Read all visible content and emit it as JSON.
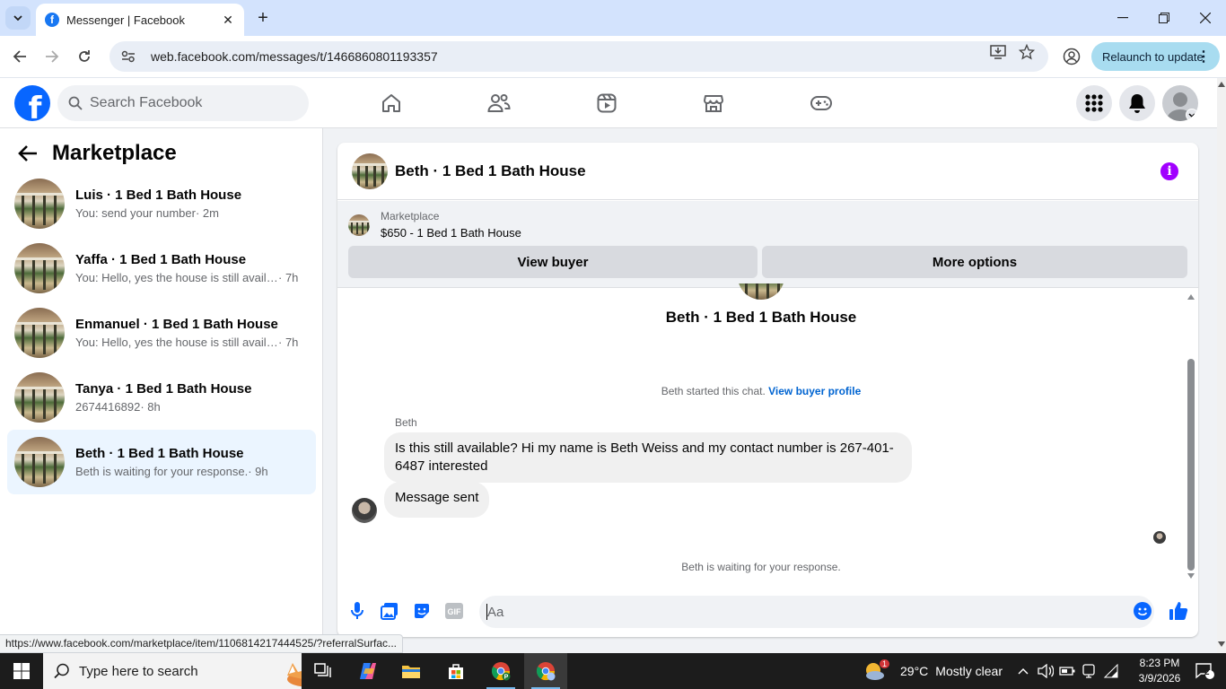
{
  "browser": {
    "tab_title": "Messenger | Facebook",
    "url": "web.facebook.com/messages/t/1466860801193357",
    "relaunch_label": "Relaunch to update",
    "status_url": "https://www.facebook.com/marketplace/item/1106814217444525/?referralSurfac..."
  },
  "header": {
    "search_placeholder": "Search Facebook",
    "nav": [
      "home-icon",
      "friends-icon",
      "watch-icon",
      "marketplace-icon",
      "gaming-icon"
    ]
  },
  "sidebar": {
    "title": "Marketplace",
    "conversations": [
      {
        "name": "Luis · 1 Bed 1 Bath House",
        "snippet": "You: send your number",
        "time": "· 2m",
        "active": false
      },
      {
        "name": "Yaffa · 1 Bed 1 Bath House",
        "snippet": "You: Hello, yes the house is still available",
        "time": "· 7h",
        "active": false
      },
      {
        "name": "Enmanuel · 1 Bed 1 Bath House",
        "snippet": "You: Hello, yes the house is still available",
        "time": "· 7h",
        "active": false
      },
      {
        "name": "Tanya · 1 Bed 1 Bath House",
        "snippet": "2674416892",
        "time": "· 8h",
        "active": false
      },
      {
        "name": "Beth · 1 Bed 1 Bath House",
        "snippet": "Beth is waiting for your response.",
        "time": "· 9h",
        "active": true
      }
    ]
  },
  "chat": {
    "title": "Beth · 1 Bed 1 Bath House",
    "marketplace_label": "Marketplace",
    "listing": "$650 - 1 Bed 1 Bath House",
    "view_buyer": "View buyer",
    "more_options": "More options",
    "center_name": "Beth · 1 Bed 1 Bath House",
    "started_text": "Beth started this chat.",
    "view_buyer_profile": "View buyer profile",
    "sender": "Beth",
    "message_1": "Is this still available? Hi my name is Beth Weiss and my contact number is 267-401-6487 interested",
    "message_2": "Message sent",
    "waiting": "Beth is waiting for your response.",
    "composer_placeholder": "Aa"
  },
  "taskbar": {
    "search_placeholder": "Type here to search",
    "weather_temp": "29°C",
    "weather_desc": "Mostly clear",
    "weather_badge": "1",
    "time": "8:23 PM",
    "date": "3/9/2026",
    "notification_count": "2"
  },
  "colors": {
    "facebook_blue": "#0866ff",
    "active_conversation_bg": "#ebf5ff",
    "info_purple": "#a100ff",
    "link_blue": "#0064d1"
  }
}
